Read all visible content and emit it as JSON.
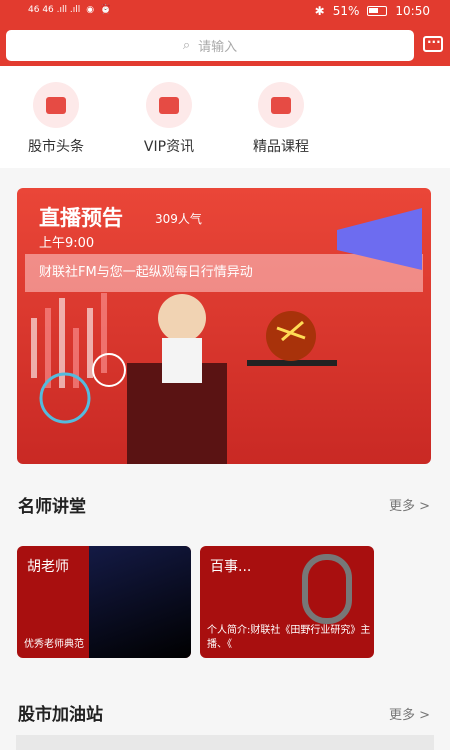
{
  "status": {
    "left": "46 46 .ıll .ıll",
    "battery": "51%",
    "time": "10:50"
  },
  "search": {
    "placeholder": "请输入"
  },
  "quick": [
    "股市头条",
    "VIP资讯",
    "精品课程"
  ],
  "banner": {
    "title": "直播预告",
    "popularity": "309人气",
    "time": "上午9:00",
    "subtitle": "财联社FM与您一起纵观每日行情异动"
  },
  "sections": {
    "teachers": "名师讲堂",
    "station": "股市加油站",
    "more": "更多 >"
  },
  "cards": [
    {
      "name": "胡老师",
      "desc": "优秀老师典范"
    },
    {
      "name": "百事...",
      "desc": "个人简介:财联社《田野行业研究》主播、《"
    }
  ],
  "colors": {
    "brand": "#e23b2f",
    "card": "#a80f0f"
  }
}
